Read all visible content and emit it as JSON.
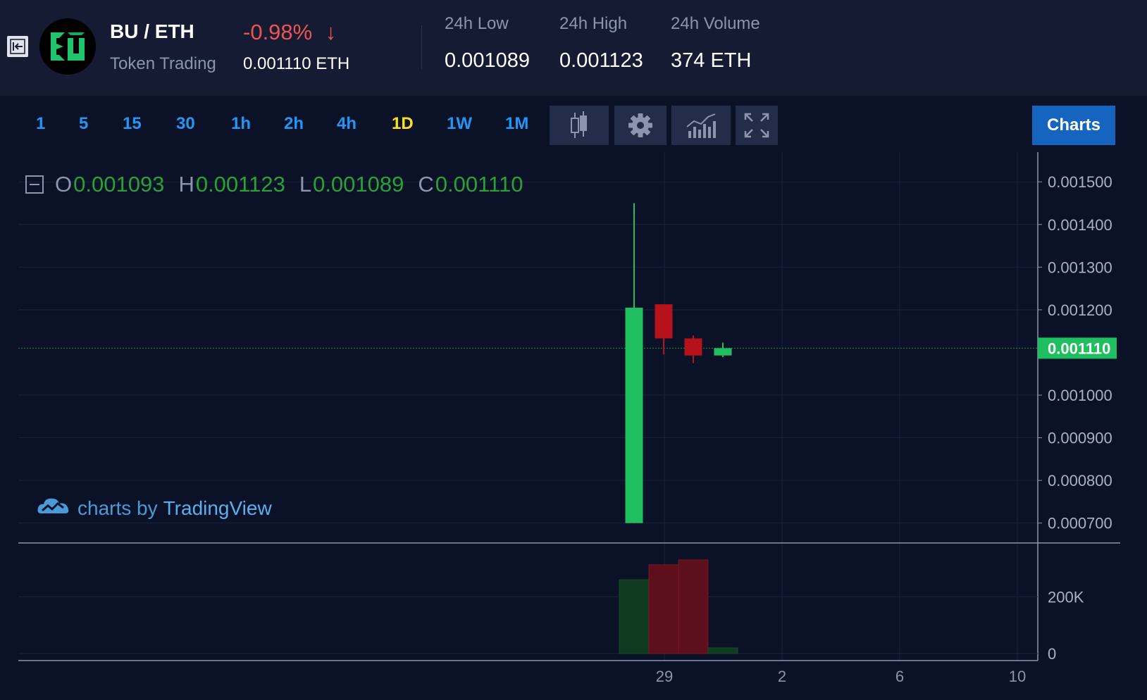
{
  "header": {
    "pair": "BU / ETH",
    "subtitle": "Token Trading",
    "change": "-0.98%",
    "change_arrow": "↓",
    "price": "0.001110 ETH",
    "stats": [
      {
        "label": "24h Low",
        "value": "0.001089"
      },
      {
        "label": "24h High",
        "value": "0.001123"
      },
      {
        "label": "24h Volume",
        "value": "374 ETH"
      }
    ],
    "logo_icon": "bu-logo-icon",
    "collapse_icon": "collapse-left-icon"
  },
  "toolbar": {
    "intervals": [
      "1",
      "5",
      "15",
      "30",
      "1h",
      "2h",
      "4h",
      "1D",
      "1W",
      "1M"
    ],
    "active_interval": "1D",
    "tools": [
      "candlestick-icon",
      "gear-icon",
      "indicators-icon",
      "fullscreen-icon"
    ],
    "charts_label": "Charts"
  },
  "legend": {
    "o_label": "O",
    "o_value": "0.001093",
    "h_label": "H",
    "h_value": "0.001123",
    "l_label": "L",
    "l_value": "0.001089",
    "c_label": "C",
    "c_value": "0.001110"
  },
  "watermark": {
    "prefix": "charts by",
    "brand": "TradingView",
    "icon": "tradingview-cloud-icon"
  },
  "colors": {
    "up": "#1fbf5f",
    "down": "#b5121b",
    "accent": "#1565c0",
    "active_interval": "#f7e21d",
    "interval": "#2196f3"
  },
  "chart_data": {
    "type": "candlestick",
    "y_ticks": [
      "0.001500",
      "0.001400",
      "0.001300",
      "0.001200",
      "0.001000",
      "0.000900",
      "0.000800",
      "0.000700"
    ],
    "ylim": [
      0.000655,
      0.00154
    ],
    "x_ticks": [
      "29",
      "2",
      "6",
      "10"
    ],
    "last_price_label": "0.001110",
    "candles": [
      {
        "open": 0.0007,
        "high": 0.00145,
        "low": 0.0007,
        "close": 0.001205
      },
      {
        "open": 0.001213,
        "high": 0.001213,
        "low": 0.001095,
        "close": 0.001133
      },
      {
        "open": 0.001133,
        "high": 0.00114,
        "low": 0.001075,
        "close": 0.001093
      },
      {
        "open": 0.001093,
        "high": 0.001123,
        "low": 0.001089,
        "close": 0.00111
      }
    ],
    "volume": {
      "ticks": [
        "200K",
        "0"
      ],
      "ylim": [
        0,
        340000
      ],
      "values": [
        260000,
        313000,
        330000,
        20000
      ],
      "directions": [
        "up",
        "down",
        "down",
        "up"
      ]
    },
    "grid": true
  }
}
